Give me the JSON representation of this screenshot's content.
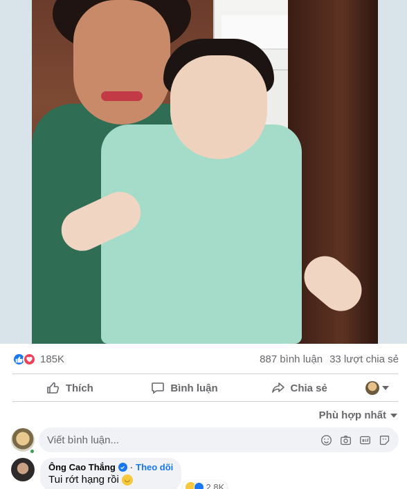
{
  "post": {
    "reactions_count": "185K",
    "comments_count": "887 bình luận",
    "shares_count": "33 lượt chia sẻ"
  },
  "actions": {
    "like": "Thích",
    "comment": "Bình luận",
    "share": "Chia sẻ"
  },
  "sort": {
    "label": "Phù hợp nhất"
  },
  "composer": {
    "placeholder": "Viết bình luận..."
  },
  "comment": {
    "author": "Ông Cao Thắng",
    "follow": "Theo dõi",
    "text": "Tui rớt hạng rồi",
    "reactions": "2,8K"
  },
  "colors": {
    "accent": "#1877f2",
    "love": "#f33e58",
    "muted": "#65676b"
  }
}
